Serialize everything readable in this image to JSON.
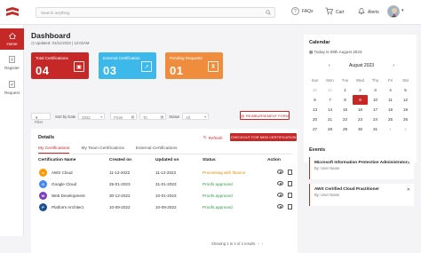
{
  "search": {
    "placeholder": "Search anything"
  },
  "topbar": {
    "faqs": "FAQs",
    "cart": "Cart",
    "alerts": "Alerts"
  },
  "sidebar": {
    "items": [
      {
        "label": "Home"
      },
      {
        "label": "Register"
      },
      {
        "label": "Request"
      }
    ]
  },
  "dashboard": {
    "title": "Dashboard",
    "updated": "Updated: 01/11/2023 | 12:02AM"
  },
  "cards": [
    {
      "label": "Total Certifications",
      "value": "04",
      "color": "#c62828"
    },
    {
      "label": "External Certification",
      "value": "03",
      "color": "#3db8ea"
    },
    {
      "label": "Pending Requests",
      "value": "01",
      "color": "#f08c3e"
    }
  ],
  "filters": {
    "filter": "Filter",
    "sort": "Sort by Date",
    "year": "2022",
    "from": "From",
    "to": "To",
    "status": "Status",
    "status_value": "All",
    "reimbursement": "REIMBURSEMENT FORM"
  },
  "details": {
    "title": "Details",
    "refresh": "Refresh",
    "checkout": "CHECKOUT FOR NEW CERTIFICATION",
    "tabs": [
      "My Certifications",
      "My Team Certifications",
      "External Certifications"
    ],
    "headers": [
      "Certification Name",
      "Created on",
      "Updated on",
      "Status",
      "Action"
    ],
    "rows": [
      {
        "name": "AWS Cloud",
        "created": "11-12-2022",
        "updated": "11-12-2022",
        "status": "Processing with finance",
        "icon": "aws-icon",
        "color": "#ff9900"
      },
      {
        "name": "Google Cloud",
        "created": "25-01-2023",
        "updated": "31-01-2023",
        "status": "Proofs approved",
        "icon": "google-cloud-icon",
        "color": "#4285f4"
      },
      {
        "name": "Web Development",
        "created": "30-12-2022",
        "updated": "10-01-2023",
        "status": "Proofs approved",
        "icon": "web-icon",
        "color": "#7a3fbf"
      },
      {
        "name": "Platform Architect",
        "created": "10-09-2022",
        "updated": "10-09-2022",
        "status": "Proofs approved",
        "icon": "platform-icon",
        "color": "#1d4f91"
      }
    ],
    "pager": "Showing 1 to 4 of 4 results"
  },
  "calendar": {
    "title": "Calendar",
    "today": "Today is 09th August 2023",
    "month": "August 2023",
    "days": [
      "Sun",
      "Mon",
      "Tue",
      "Wed",
      "Thu",
      "Fri",
      "Sat"
    ],
    "weeks": [
      [
        "30",
        "31",
        "1",
        "2",
        "3",
        "4",
        "5"
      ],
      [
        "6",
        "7",
        "8",
        "9",
        "10",
        "11",
        "12"
      ],
      [
        "13",
        "14",
        "15",
        "16",
        "17",
        "18",
        "19"
      ],
      [
        "20",
        "21",
        "22",
        "23",
        "24",
        "25",
        "26"
      ],
      [
        "27",
        "28",
        "29",
        "30",
        "31",
        "1",
        "2"
      ]
    ],
    "selected": "9"
  },
  "events": {
    "title": "Events",
    "items": [
      {
        "title": "Microsoft Information Protection Administrator",
        "by": "By: User Name"
      },
      {
        "title": "AWS Certified Cloud Practitioner",
        "by": "By: User Name"
      }
    ]
  }
}
